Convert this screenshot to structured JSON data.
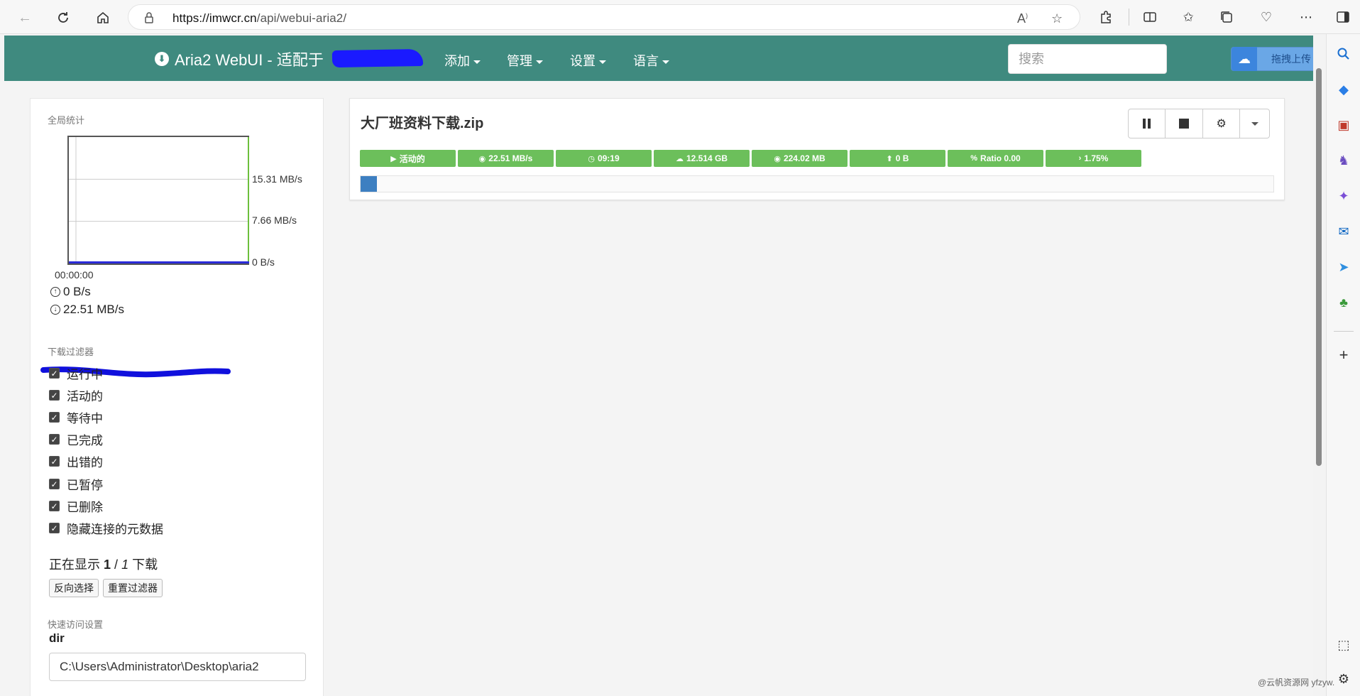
{
  "browser": {
    "url_host": "https://imwcr.cn",
    "url_path": "/api/webui-aria2/"
  },
  "navbar": {
    "brand": "Aria2 WebUI - 适配于",
    "menus": [
      "添加",
      "管理",
      "设置",
      "语言"
    ],
    "search_placeholder": "搜索",
    "upload_label": "拖拽上传",
    "upload_icon": "cloud-icon"
  },
  "stats": {
    "title": "全局统计",
    "ticks": [
      "15.31 MB/s",
      "7.66 MB/s",
      "0 B/s"
    ],
    "time_label": "00:00:00",
    "upload_speed": "0 B/s",
    "download_speed": "22.51 MB/s"
  },
  "chart_data": {
    "type": "line",
    "title": "",
    "x": [
      "00:00:00"
    ],
    "series": [
      {
        "values": [
          0
        ]
      },
      {
        "values": [
          0
        ]
      }
    ],
    "ylim": [
      0,
      22.97
    ],
    "yticks": [
      "0 B/s",
      "7.66 MB/s",
      "15.31 MB/s"
    ],
    "colors": [
      "#2b2bd8",
      "#6cbf3c"
    ]
  },
  "filters": {
    "title": "下载过滤器",
    "items": [
      "运行中",
      "活动的",
      "等待中",
      "已完成",
      "出错的",
      "已暂停",
      "已删除",
      "隐藏连接的元数据"
    ],
    "showing_prefix": "正在显示",
    "showing_count": "1",
    "showing_sep": "/",
    "showing_total": "1",
    "showing_suffix": "下载",
    "invert_btn": "反向选择",
    "reset_btn": "重置过滤器"
  },
  "quick": {
    "title": "快速访问设置",
    "dir_label": "dir",
    "dir_value": "C:\\Users\\Administrator\\Desktop\\aria2"
  },
  "download": {
    "name": "大厂班资料下载.zip",
    "badges": [
      {
        "icon": "play-icon",
        "glyph": "▶",
        "text": "活动的"
      },
      {
        "icon": "speed-icon",
        "glyph": "◉",
        "text": "22.51 MB/s"
      },
      {
        "icon": "clock-icon",
        "glyph": "◷",
        "text": "09:19"
      },
      {
        "icon": "cloud-download-icon",
        "glyph": "☁",
        "text": "12.514 GB"
      },
      {
        "icon": "download-size-icon",
        "glyph": "◉",
        "text": "224.02 MB"
      },
      {
        "icon": "upload-icon",
        "glyph": "⬆",
        "text": "0 B"
      },
      {
        "icon": "percent-icon",
        "glyph": "%",
        "text": "Ratio 0.00"
      },
      {
        "icon": "chevron-right-icon",
        "glyph": "›",
        "text": "1.75%"
      }
    ],
    "progress": 0.0175,
    "accent": "#6cbf5b"
  },
  "watermark": "@云帆资源网 yfzyw."
}
